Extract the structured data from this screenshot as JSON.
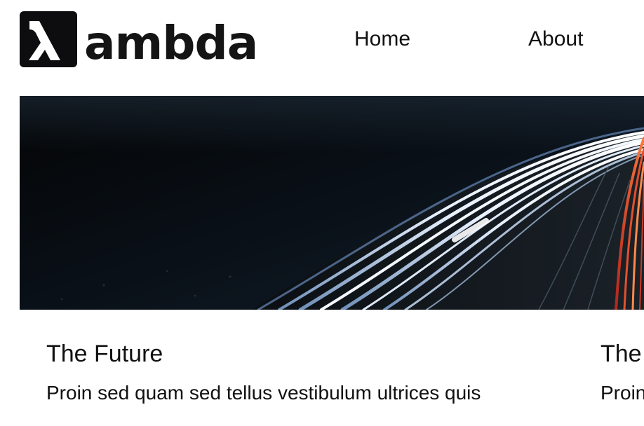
{
  "header": {
    "logo": {
      "wordmark": "ambda",
      "badge_glyph": "λ",
      "icon": "lambda-logo-icon"
    },
    "nav": [
      {
        "label": "Home"
      },
      {
        "label": "About"
      }
    ]
  },
  "hero": {
    "image": "night-highway-light-trails"
  },
  "cards": [
    {
      "title": "The Future",
      "body": "Proin sed quam sed tellus vestibulum ultrices quis"
    },
    {
      "title": "The",
      "body": "Proin"
    }
  ],
  "colors": {
    "text": "#111111",
    "logo_badge": "#0d0d0f",
    "background": "#ffffff"
  }
}
